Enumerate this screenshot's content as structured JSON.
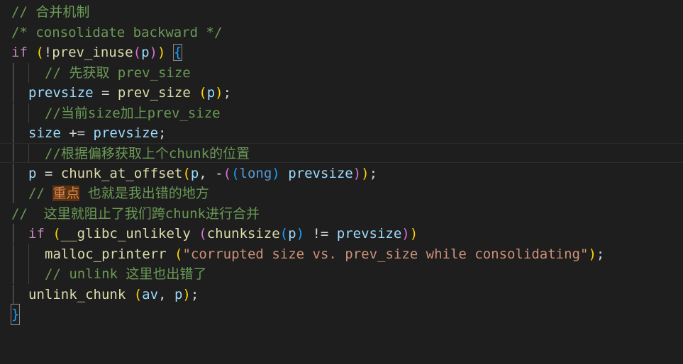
{
  "code": {
    "l1": "// 合并机制",
    "l2": "/* consolidate backward */",
    "l3": {
      "if": "if",
      "open": " (",
      "not": "!",
      "fn": "prev_inuse",
      "po": "(",
      "arg": "p",
      "pc": ")",
      "close": ")",
      "sp": " ",
      "brace": "{"
    },
    "l4": "// 先获取 prev_size",
    "l5": {
      "lhs": "prevsize",
      "eq": " = ",
      "fn": "prev_size",
      "po": " (",
      "arg": "p",
      "pc": ")",
      "semi": ";"
    },
    "l6": "//当前size加上prev_size",
    "l7": {
      "lhs": "size",
      "op": " += ",
      "rhs": "prevsize",
      "semi": ";"
    },
    "l8": "//根据偏移获取上个chunk的位置",
    "l9": {
      "lhs": "p",
      "eq": " = ",
      "fn": "chunk_at_offset",
      "po": "(",
      "a1": "p",
      "comma": ", ",
      "minus": "-",
      "o2": "(",
      "o3": "(",
      "type": "long",
      "c3": ")",
      "sp": " ",
      "a2": "prevsize",
      "c2": ")",
      "pc": ")",
      "semi": ";"
    },
    "l10": {
      "pre": "// ",
      "hl": "重点",
      "post": " 也就是我出错的地方"
    },
    "l11": "//  这里就阻止了我们跨chunk进行合并",
    "l12": {
      "if": "if",
      "po": " (",
      "fn": "__glibc_unlikely",
      "o2": " (",
      "fn2": "chunksize",
      "o3": "(",
      "arg": "p",
      "c3": ")",
      "neq": " != ",
      "rhs": "prevsize",
      "c2": ")",
      "pc": ")"
    },
    "l13": {
      "fn": "malloc_printerr",
      "po": " (",
      "str": "\"corrupted size vs. prev_size while consolidating\"",
      "pc": ")",
      "semi": ";"
    },
    "l14": "// unlink 这里也出错了",
    "l15": {
      "fn": "unlink_chunk",
      "po": " (",
      "a1": "av",
      "comma": ", ",
      "a2": "p",
      "pc": ")",
      "semi": ";"
    },
    "l16": "}"
  },
  "colors": {
    "background": "#1e1e1e",
    "comment": "#6a9955",
    "control_keyword": "#c586c0",
    "type_keyword": "#569cd6",
    "variable": "#9cdcfe",
    "function": "#dcdcaa",
    "string": "#ce9178",
    "bracket_level1": "#ffd700",
    "bracket_level2": "#da70d6",
    "bracket_level3": "#179fff"
  }
}
